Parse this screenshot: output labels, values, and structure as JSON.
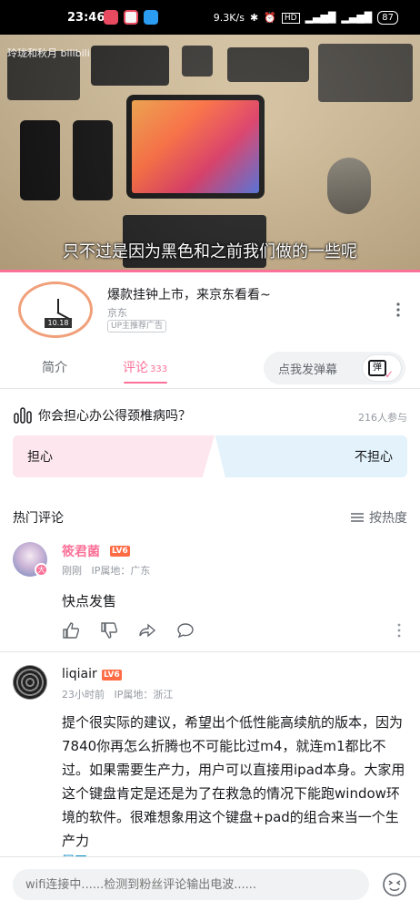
{
  "status_bar": {
    "time": "23:46",
    "net_speed": "9.3K/s",
    "hd_label": "HD",
    "battery": "87"
  },
  "video": {
    "watermark": "玲珑和秋月 bilibili",
    "subtitle": "只不过是因为黑色和之前我们做的一些呢"
  },
  "ad": {
    "title": "爆款挂钟上市，来京东看看~",
    "source": "京东",
    "tag": "UP主推荐广告",
    "clock_display": "10.18"
  },
  "tabs": {
    "intro": "简介",
    "comments": "评论",
    "comment_count": "333",
    "danmaku_placeholder": "点我发弹幕",
    "danmaku_icon_text": "弹"
  },
  "poll": {
    "question": "你会担心办公得颈椎病吗？",
    "participants": "216人参与",
    "option_left": "担心",
    "option_right": "不担心"
  },
  "comments_header": {
    "title": "热门评论",
    "sort_label": "按热度"
  },
  "comments": [
    {
      "username": "筱君菌",
      "level": "LV6",
      "time": "刚刚",
      "ip": "IP属地：广东",
      "text": "快点发售",
      "avatar_badge": "大"
    },
    {
      "username": "liqiair",
      "level": "LV6",
      "time": "23小时前",
      "ip": "IP属地：浙江",
      "text": "提个很实际的建议，希望出个低性能高续航的版本，因为7840你再怎么折腾也不可能比过m4，就连m1都比不过。如果需要生产力，用户可以直接用ipad本身。大家用这个键盘肯定是还是为了在救急的情况下能跑window环境的软件。很难想象用这个键盘+pad的组合来当一个生产力",
      "expand": "展开"
    }
  ],
  "bottom": {
    "placeholder": "wifi连接中......检测到粉丝评论输出电波......"
  },
  "colors": {
    "accent": "#fb7299",
    "link": "#008ac5",
    "poll_left": "#fde6ed",
    "poll_right": "#e3f2fb"
  }
}
